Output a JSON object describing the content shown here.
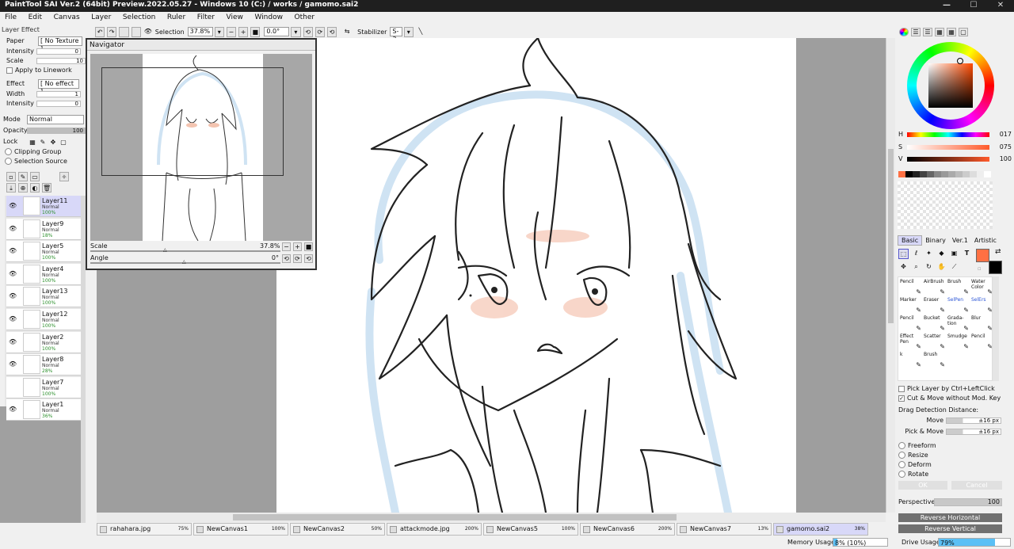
{
  "title": "PaintTool SAI Ver.2 (64bit) Preview.2022.05.27 - Windows 10 (C:) / works / gamomo.sai2",
  "window_buttons": {
    "minimize": "—",
    "maximize": "☐",
    "close": "✕"
  },
  "menu": [
    "File",
    "Edit",
    "Canvas",
    "Layer",
    "Selection",
    "Ruler",
    "Filter",
    "View",
    "Window",
    "Other"
  ],
  "toolbar": {
    "selection_label": "Selection",
    "zoom": "37.8%",
    "angle": "0.0°",
    "stabilizer_label": "Stabilizer",
    "stabilizer": "S-3"
  },
  "layer_effect": {
    "header": "Layer Effect",
    "paper_label": "Paper",
    "paper_value": "[ No Texture ]",
    "intensity_label": "Intensity",
    "intensity_value": "0",
    "scale_label": "Scale",
    "scale_value": "10",
    "apply_linework": "Apply to Linework",
    "effect_label": "Effect",
    "effect_value": "[ No effect ]",
    "width_label": "Width",
    "width_value": "1",
    "intensity2_label": "Intensity",
    "intensity2_value": "0"
  },
  "layer_props": {
    "mode_label": "Mode",
    "mode_value": "Normal",
    "opacity_label": "Opacity",
    "opacity_value": "100",
    "lock_label": "Lock",
    "clipping": "Clipping Group",
    "selection_source": "Selection Source"
  },
  "layers": [
    {
      "name": "Layer11",
      "mode": "Normal",
      "opacity": "100%"
    },
    {
      "name": "Layer9",
      "mode": "Normal",
      "opacity": "18%"
    },
    {
      "name": "Layer5",
      "mode": "Normal",
      "opacity": "100%"
    },
    {
      "name": "Layer4",
      "mode": "Normal",
      "opacity": "100%"
    },
    {
      "name": "Layer13",
      "mode": "Normal",
      "opacity": "100%"
    },
    {
      "name": "Layer12",
      "mode": "Normal",
      "opacity": "100%"
    },
    {
      "name": "Layer2",
      "mode": "Normal",
      "opacity": "100%"
    },
    {
      "name": "Layer8",
      "mode": "Normal",
      "opacity": "28%"
    },
    {
      "name": "Layer7",
      "mode": "Normal",
      "opacity": "100%"
    },
    {
      "name": "Layer1",
      "mode": "Normal",
      "opacity": "36%"
    }
  ],
  "navigator": {
    "title": "Navigator",
    "scale_label": "Scale",
    "scale_value": "37.8%",
    "angle_label": "Angle",
    "angle_value": "0°"
  },
  "tabs": [
    {
      "name": "rahahara.jpg",
      "pct": "75%"
    },
    {
      "name": "NewCanvas1",
      "pct": "100%"
    },
    {
      "name": "NewCanvas2",
      "pct": "50%"
    },
    {
      "name": "attackmode.jpg",
      "pct": "200%"
    },
    {
      "name": "NewCanvas5",
      "pct": "100%"
    },
    {
      "name": "NewCanvas6",
      "pct": "200%"
    },
    {
      "name": "NewCanvas7",
      "pct": "13%"
    },
    {
      "name": "gamomo.sai2",
      "pct": "38%"
    }
  ],
  "status": {
    "memory_label": "Memory Usage",
    "memory_value": "8% (10%)",
    "memory_fraction": 0.08,
    "drive_label": "Drive Usage",
    "drive_value": "79%",
    "drive_fraction": 0.79
  },
  "color": {
    "h_label": "H",
    "h_value": "017",
    "s_label": "S",
    "s_value": "075",
    "v_label": "V",
    "v_value": "100",
    "foreground": "#ff7043",
    "background": "#000000"
  },
  "tool_tabs": [
    "Basic",
    "Binary",
    "Ver.1",
    "Artistic"
  ],
  "brushes": [
    {
      "l1": "Pencil",
      "l2": ""
    },
    {
      "l1": "AirBrush",
      "l2": ""
    },
    {
      "l1": "Brush",
      "l2": ""
    },
    {
      "l1": "Water",
      "l2": "Color"
    },
    {
      "l1": "Marker",
      "l2": ""
    },
    {
      "l1": "Eraser",
      "l2": ""
    },
    {
      "l1": "SelPen",
      "l2": ""
    },
    {
      "l1": "SelErs",
      "l2": ""
    },
    {
      "l1": "Pencil",
      "l2": ""
    },
    {
      "l1": "Bucket",
      "l2": ""
    },
    {
      "l1": "Grada-",
      "l2": "tion"
    },
    {
      "l1": "Blur",
      "l2": ""
    },
    {
      "l1": "Effect",
      "l2": "Pen"
    },
    {
      "l1": "Scatter",
      "l2": ""
    },
    {
      "l1": "Smudge",
      "l2": ""
    },
    {
      "l1": "Pencil",
      "l2": ""
    },
    {
      "l1": "k",
      "l2": ""
    },
    {
      "l1": "Brush",
      "l2": ""
    }
  ],
  "options": {
    "pick_layer": "Pick Layer by Ctrl+LeftClick",
    "cut_move": "Cut & Move without Mod. Key",
    "drag_label": "Drag Detection Distance:",
    "move_label": "Move",
    "move_value": "±16 px",
    "pickmove_label": "Pick & Move",
    "pickmove_value": "±16 px"
  },
  "transform": {
    "freeform": "Freeform",
    "resize": "Resize",
    "deform": "Deform",
    "rotate": "Rotate",
    "ok": "OK",
    "cancel": "Cancel"
  },
  "perspective": {
    "label": "Perspective",
    "value": "100"
  },
  "reverse": {
    "horizontal": "Reverse Horizontal",
    "vertical": "Reverse Vertical"
  }
}
